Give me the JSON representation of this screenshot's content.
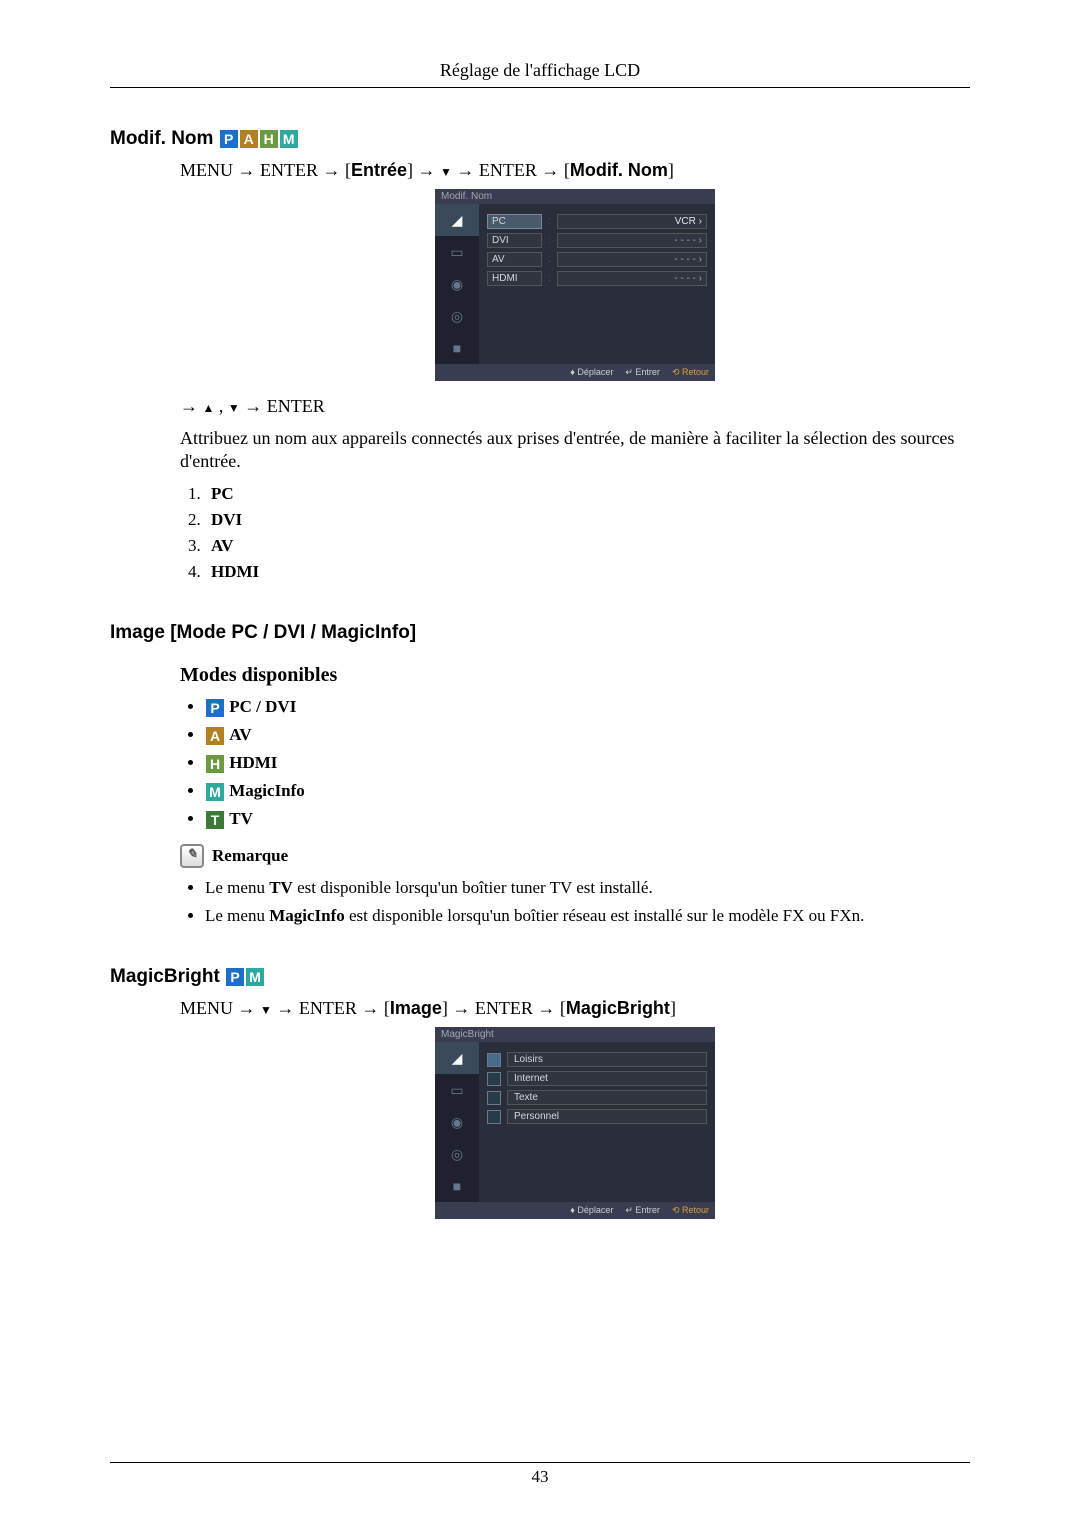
{
  "header": {
    "title": "Réglage de l'affichage LCD"
  },
  "section1": {
    "title": "Modif. Nom",
    "nav": {
      "t1": "MENU → ENTER → ",
      "b1": "Entrée",
      "t2": " → ",
      "arrow_down": "▼",
      "t3": " → ENTER → ",
      "b2": "Modif. Nom"
    },
    "osd": {
      "title": "Modif. Nom",
      "rows": [
        {
          "label": "PC",
          "value": "VCR ›",
          "hl": true
        },
        {
          "label": "DVI",
          "value": "- - - - ›"
        },
        {
          "label": "AV",
          "value": "- - - - ›"
        },
        {
          "label": "HDMI",
          "value": "- - - - ›"
        }
      ],
      "foot_move": "Déplacer",
      "foot_enter": "Entrer",
      "foot_return": "Retour"
    },
    "nav2": {
      "t1": "→ ",
      "up": "▲",
      "comma": " , ",
      "down": "▼",
      "t2": " → ENTER"
    },
    "body": "Attribuez un nom aux appareils connectés aux prises d'entrée, de manière à faciliter la sélection des sources d'entrée.",
    "list": [
      "PC",
      "DVI",
      "AV",
      "HDMI"
    ]
  },
  "section2": {
    "title": "Image [Mode PC / DVI / MagicInfo]",
    "subtitle": "Modes disponibles",
    "modes": [
      {
        "badge": "P",
        "cls": "badge-P",
        "label": "PC / DVI"
      },
      {
        "badge": "A",
        "cls": "badge-A",
        "label": "AV"
      },
      {
        "badge": "H",
        "cls": "badge-H",
        "label": "HDMI"
      },
      {
        "badge": "M",
        "cls": "badge-M",
        "label": "MagicInfo"
      },
      {
        "badge": "T",
        "cls": "badge-T",
        "label": "TV"
      }
    ],
    "note_label": "Remarque",
    "notes": {
      "n1a": "Le menu ",
      "n1b": "TV",
      "n1c": " est disponible lorsqu'un boîtier tuner TV est installé.",
      "n2a": "Le menu ",
      "n2b": "MagicInfo",
      "n2c": " est disponible lorsqu'un boîtier réseau est installé sur le modèle FX ou FXn."
    }
  },
  "section3": {
    "title": "MagicBright",
    "nav": {
      "t1": "MENU → ",
      "down": "▼",
      "t2": " → ENTER → ",
      "b1": "Image",
      "t3": " → ENTER → ",
      "b2": "MagicBright"
    },
    "osd": {
      "title": "MagicBright",
      "items": [
        "Loisirs",
        "Internet",
        "Texte",
        "Personnel"
      ],
      "foot_move": "Déplacer",
      "foot_enter": "Entrer",
      "foot_return": "Retour"
    }
  },
  "footer": {
    "page": "43"
  },
  "badges": {
    "P": "P",
    "A": "A",
    "H": "H",
    "M": "M",
    "T": "T"
  }
}
